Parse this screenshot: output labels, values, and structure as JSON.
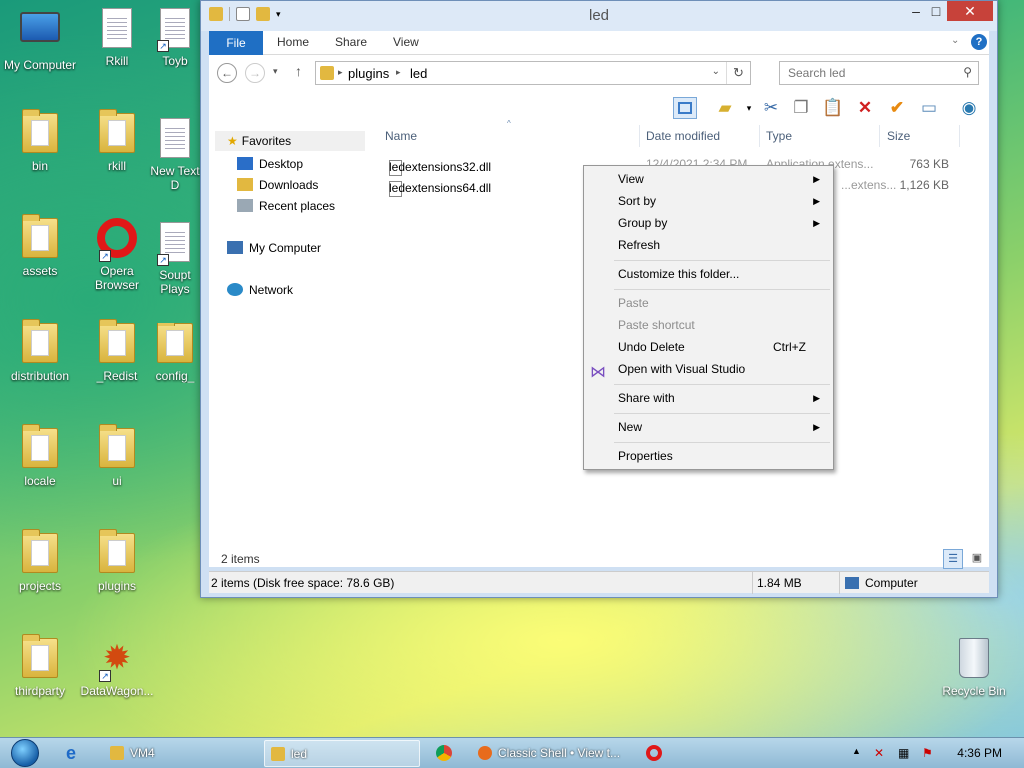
{
  "desktop": {
    "icons": [
      {
        "label": "My Computer"
      },
      {
        "label": "Rkill"
      },
      {
        "label": "Toyb"
      },
      {
        "label": "bin"
      },
      {
        "label": "rkill"
      },
      {
        "label": "New Text D"
      },
      {
        "label": "assets"
      },
      {
        "label": "Opera Browser"
      },
      {
        "label": "Soupt Plays"
      },
      {
        "label": "distribution"
      },
      {
        "label": "_Redist"
      },
      {
        "label": "config_"
      },
      {
        "label": "locale"
      },
      {
        "label": "ui"
      },
      {
        "label": "projects"
      },
      {
        "label": "plugins"
      },
      {
        "label": "thirdparty"
      },
      {
        "label": "DataWagon..."
      },
      {
        "label": "Recycle Bin"
      }
    ]
  },
  "window": {
    "title": "led",
    "ribbon_tabs": {
      "file": "File",
      "home": "Home",
      "share": "Share",
      "view": "View"
    },
    "address": {
      "crumb1": "plugins",
      "crumb2": "led"
    },
    "search": {
      "placeholder": "Search led"
    },
    "nav": {
      "favorites": "Favorites",
      "desktop": "Desktop",
      "downloads": "Downloads",
      "recent": "Recent places",
      "computer": "My Computer",
      "network": "Network"
    },
    "columns": {
      "name": "Name",
      "date": "Date modified",
      "type": "Type",
      "size": "Size"
    },
    "files": [
      {
        "name": "ledextensions32.dll",
        "date": "12/4/2021 2:34 PM",
        "type": "Application extens...",
        "size": "763 KB"
      },
      {
        "name": "ledextensions64.dll",
        "date": "",
        "type": "...extens...",
        "size": "1,126 KB"
      }
    ],
    "item_count": "2 items",
    "status": {
      "left": "2 items (Disk free space: 78.6 GB)",
      "size": "1.84 MB",
      "location": "Computer"
    }
  },
  "context_menu": {
    "view": "View",
    "sort_by": "Sort by",
    "group_by": "Group by",
    "refresh": "Refresh",
    "customize": "Customize this folder...",
    "paste": "Paste",
    "paste_shortcut": "Paste shortcut",
    "undo_delete": "Undo Delete",
    "undo_accel": "Ctrl+Z",
    "open_vs": "Open with Visual Studio",
    "share_with": "Share with",
    "new": "New",
    "properties": "Properties"
  },
  "taskbar": {
    "tasks": [
      {
        "label": "VM4"
      },
      {
        "label": "led"
      },
      {
        "label": "Classic Shell • View t..."
      }
    ],
    "clock": "4:36 PM"
  }
}
